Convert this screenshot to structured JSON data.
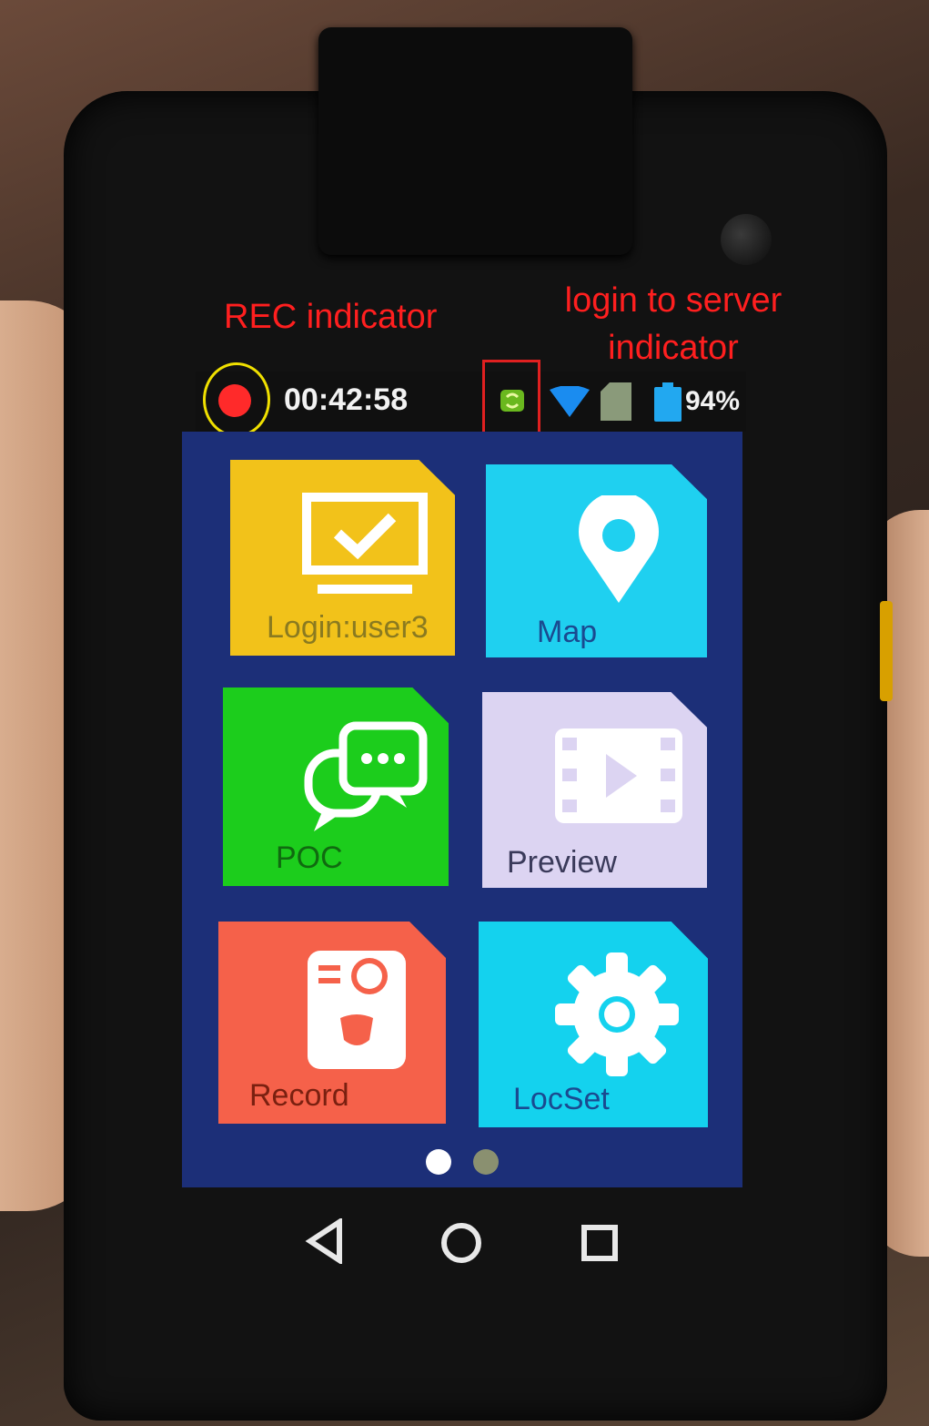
{
  "annotations": {
    "rec_indicator": "REC indicator",
    "login_indicator_line1": "login to server",
    "login_indicator_line2": "indicator"
  },
  "statusbar": {
    "rec_timer": "00:42:58",
    "battery_percent": "94%",
    "icons": [
      "rec-dot-icon",
      "server-login-icon",
      "wifi-icon",
      "sd-card-icon",
      "battery-icon"
    ]
  },
  "tiles": [
    {
      "label": "Login:user3",
      "icon": "monitor-check-icon",
      "color": "#f2c21a",
      "label_color": "#8a7a20"
    },
    {
      "label": "Map",
      "icon": "location-pin-icon",
      "color": "#1fd0f0",
      "label_color": "#1a4a90"
    },
    {
      "label": "POC",
      "icon": "chat-bubbles-icon",
      "color": "#1ccd1c",
      "label_color": "#106a10"
    },
    {
      "label": "Preview",
      "icon": "video-play-icon",
      "color": "#dcd4f2",
      "label_color": "#3a3a5a"
    },
    {
      "label": "Record",
      "icon": "bodycam-icon",
      "color": "#f5614a",
      "label_color": "#7a2010"
    },
    {
      "label": "LocSet",
      "icon": "gear-icon",
      "color": "#14d2ee",
      "label_color": "#1a4a90"
    }
  ],
  "pager": {
    "pages": 2,
    "current": 1
  },
  "navbar": {
    "buttons": [
      "back-icon",
      "home-icon",
      "recents-icon"
    ]
  },
  "colors": {
    "screen_bg": "#1c2f78",
    "rec": "#ff2a2a",
    "annotation": "#ff1f1f"
  }
}
